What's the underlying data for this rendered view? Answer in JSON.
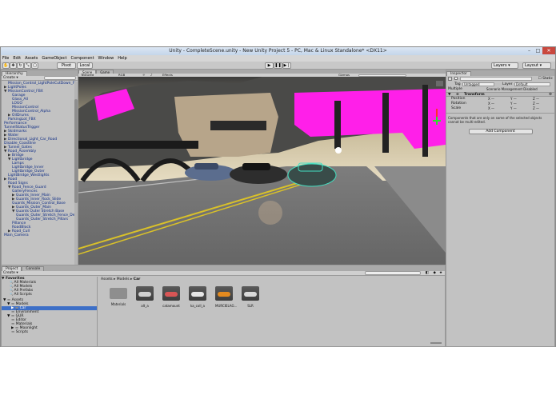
{
  "window": {
    "title": "Unity - CompleteScene.unity - New Unity Project 5 - PC, Mac & Linux Standalone* <DX11>",
    "controls": [
      "–",
      "□",
      "✕"
    ]
  },
  "menu": [
    "File",
    "Edit",
    "Assets",
    "GameObject",
    "Component",
    "Window",
    "Help"
  ],
  "toolbar": {
    "pivot": "Pivot",
    "local": "Local",
    "layers": "Layers",
    "layout": "Layout"
  },
  "hierarchy": {
    "tab": "Hierarchy",
    "create": "Create",
    "items": [
      {
        "indent": 1,
        "arrow": "",
        "label": "Mission_Control_LightPoleCutDown_Fb"
      },
      {
        "indent": 0,
        "arrow": "▶",
        "label": "LightPoles"
      },
      {
        "indent": 0,
        "arrow": "▼",
        "label": "MissionControl_FBX"
      },
      {
        "indent": 2,
        "arrow": "",
        "label": "Garage"
      },
      {
        "indent": 2,
        "arrow": "",
        "label": "Glass_All"
      },
      {
        "indent": 2,
        "arrow": "",
        "label": "LOGO"
      },
      {
        "indent": 2,
        "arrow": "",
        "label": "MissionControl"
      },
      {
        "indent": 2,
        "arrow": "",
        "label": "MissionControl_Alpha"
      },
      {
        "indent": 1,
        "arrow": "▶",
        "label": "OilDrums"
      },
      {
        "indent": 1,
        "arrow": "",
        "label": "ParkingLot_FBX"
      },
      {
        "indent": 0,
        "arrow": "",
        "label": "Performance"
      },
      {
        "indent": 0,
        "arrow": "",
        "label": "TunnelStatusTrigger"
      },
      {
        "indent": 0,
        "arrow": "▶",
        "label": "Skidmarks"
      },
      {
        "indent": 0,
        "arrow": "▶",
        "label": "Water"
      },
      {
        "indent": 0,
        "arrow": "▶",
        "label": "Directional_Light_Car_Road"
      },
      {
        "indent": 0,
        "arrow": "",
        "label": "Disable_Coastline"
      },
      {
        "indent": 0,
        "arrow": "▶",
        "label": "Tunnel_Gates"
      },
      {
        "indent": 0,
        "arrow": "▼",
        "label": "Road_Assembly"
      },
      {
        "indent": 1,
        "arrow": "▶",
        "label": "Bridge"
      },
      {
        "indent": 1,
        "arrow": "▼",
        "label": "Lightbridge"
      },
      {
        "indent": 2,
        "arrow": "",
        "label": "Lamps"
      },
      {
        "indent": 2,
        "arrow": "",
        "label": "Lightbridge_Inner"
      },
      {
        "indent": 2,
        "arrow": "",
        "label": "Lightbridge_Outer"
      },
      {
        "indent": 1,
        "arrow": "",
        "label": "LightBridge_Westlights"
      },
      {
        "indent": 0,
        "arrow": "▶",
        "label": "Road"
      },
      {
        "indent": 1,
        "arrow": "",
        "label": "Road Signs"
      },
      {
        "indent": 1,
        "arrow": "▼",
        "label": "Road_Fence_Guard"
      },
      {
        "indent": 2,
        "arrow": "",
        "label": "GalleryFences"
      },
      {
        "indent": 2,
        "arrow": "▶",
        "label": "Guards_Inner_Main"
      },
      {
        "indent": 2,
        "arrow": "▶",
        "label": "Guards_Inner_Rock_Slide"
      },
      {
        "indent": 2,
        "arrow": "",
        "label": "Guards_Mission_Control_Base"
      },
      {
        "indent": 2,
        "arrow": "▶",
        "label": "Guards_Outer_Main"
      },
      {
        "indent": 2,
        "arrow": "▼",
        "label": "Guards Outer Stretch Base"
      },
      {
        "indent": 3,
        "arrow": "",
        "label": "Guards_Outer_Stretch_Fence_Del"
      },
      {
        "indent": 3,
        "arrow": "",
        "label": "Guards_Outer_Stretch_Pillars"
      },
      {
        "indent": 2,
        "arrow": "",
        "label": "Pillance"
      },
      {
        "indent": 2,
        "arrow": "",
        "label": "RoadBlock"
      },
      {
        "indent": 1,
        "arrow": "▶",
        "label": "Road_Cull"
      },
      {
        "indent": 0,
        "arrow": "",
        "label": "Main_Camera"
      }
    ]
  },
  "scene": {
    "tabs": [
      "Scene",
      "Game"
    ],
    "shading": "Textured",
    "rgb": "RGB",
    "effects": "Effects",
    "gizmos": "Gizmos",
    "search": "All"
  },
  "inspector": {
    "tab": "Inspector",
    "static": "Static",
    "tag_label": "Tag",
    "tag_value": "Untagged",
    "layer_label": "Layer",
    "layer_value": "Default",
    "multiple": "Multiple",
    "multiple_desc": "Scenario Management Disabled",
    "transform": "Transform",
    "rows": [
      {
        "label": "Position",
        "x": "X —",
        "y": "Y —",
        "z": "Z —"
      },
      {
        "label": "Rotation",
        "x": "X —",
        "y": "Y —",
        "z": "Z —"
      },
      {
        "label": "Scale",
        "x": "X —",
        "y": "Y —",
        "z": "Z —"
      }
    ],
    "note": "Components that are only on some of the selected objects cannot be multi-edited.",
    "add_component": "Add Component"
  },
  "project": {
    "tabs": [
      "Project",
      "Console"
    ],
    "create": "Create",
    "breadcrumb": [
      "Assets",
      "Models",
      "Car"
    ],
    "favorites_label": "Favorites",
    "favorites": [
      "All Materials",
      "All Models",
      "All Prefabs",
      "All Scripts"
    ],
    "tree": [
      {
        "indent": 0,
        "arrow": "▼",
        "label": "Assets"
      },
      {
        "indent": 1,
        "arrow": "▼",
        "label": "Models"
      },
      {
        "indent": 2,
        "arrow": "▶",
        "label": "Car"
      },
      {
        "indent": 2,
        "arrow": "",
        "label": "Environment"
      },
      {
        "indent": 1,
        "arrow": "▼",
        "label": "GUR"
      },
      {
        "indent": 2,
        "arrow": "",
        "label": "Editor"
      },
      {
        "indent": 2,
        "arrow": "",
        "label": "Materials"
      },
      {
        "indent": 2,
        "arrow": "▶",
        "label": "Moonlight"
      },
      {
        "indent": 2,
        "arrow": "",
        "label": "Scripts"
      }
    ],
    "items": [
      {
        "label": "Materials",
        "kind": "folder",
        "color": "#8e8e8e"
      },
      {
        "label": "alt_a",
        "kind": "car",
        "color": "#cfcfcf"
      },
      {
        "label": "catamount",
        "kind": "car",
        "color": "#d85555"
      },
      {
        "label": "ka_coll_a",
        "kind": "car",
        "color": "#e6e6e6"
      },
      {
        "label": "MURCIELAG...",
        "kind": "car",
        "color": "#e38a1f"
      },
      {
        "label": "SLR",
        "kind": "car",
        "color": "#d9d9d9"
      }
    ]
  },
  "colors": {
    "magenta": "#ff1fe9",
    "sky": "#d3c7a8",
    "selection": "#3d6fc7"
  }
}
